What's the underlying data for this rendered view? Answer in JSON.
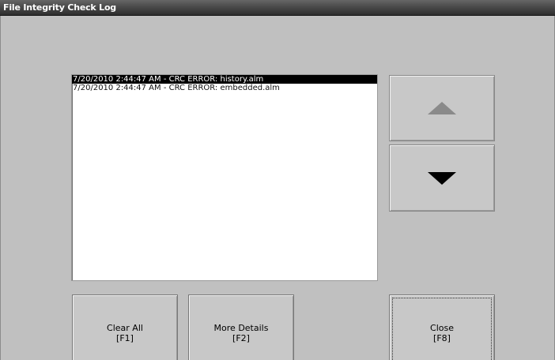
{
  "window": {
    "title": "File Integrity Check Log"
  },
  "log": {
    "entries": [
      {
        "text": "7/20/2010 2:44:47 AM - CRC ERROR: history.alm",
        "selected": true
      },
      {
        "text": "7/20/2010 2:44:47 AM - CRC ERROR: embedded.alm",
        "selected": false
      }
    ]
  },
  "scroll": {
    "up_icon": "triangle-up-icon",
    "down_icon": "triangle-down-icon"
  },
  "buttons": {
    "clear_all": {
      "label": "Clear All",
      "key": "[F1]"
    },
    "more_details": {
      "label": "More Details",
      "key": "[F2]"
    },
    "close": {
      "label": "Close",
      "key": "[F8]"
    }
  }
}
